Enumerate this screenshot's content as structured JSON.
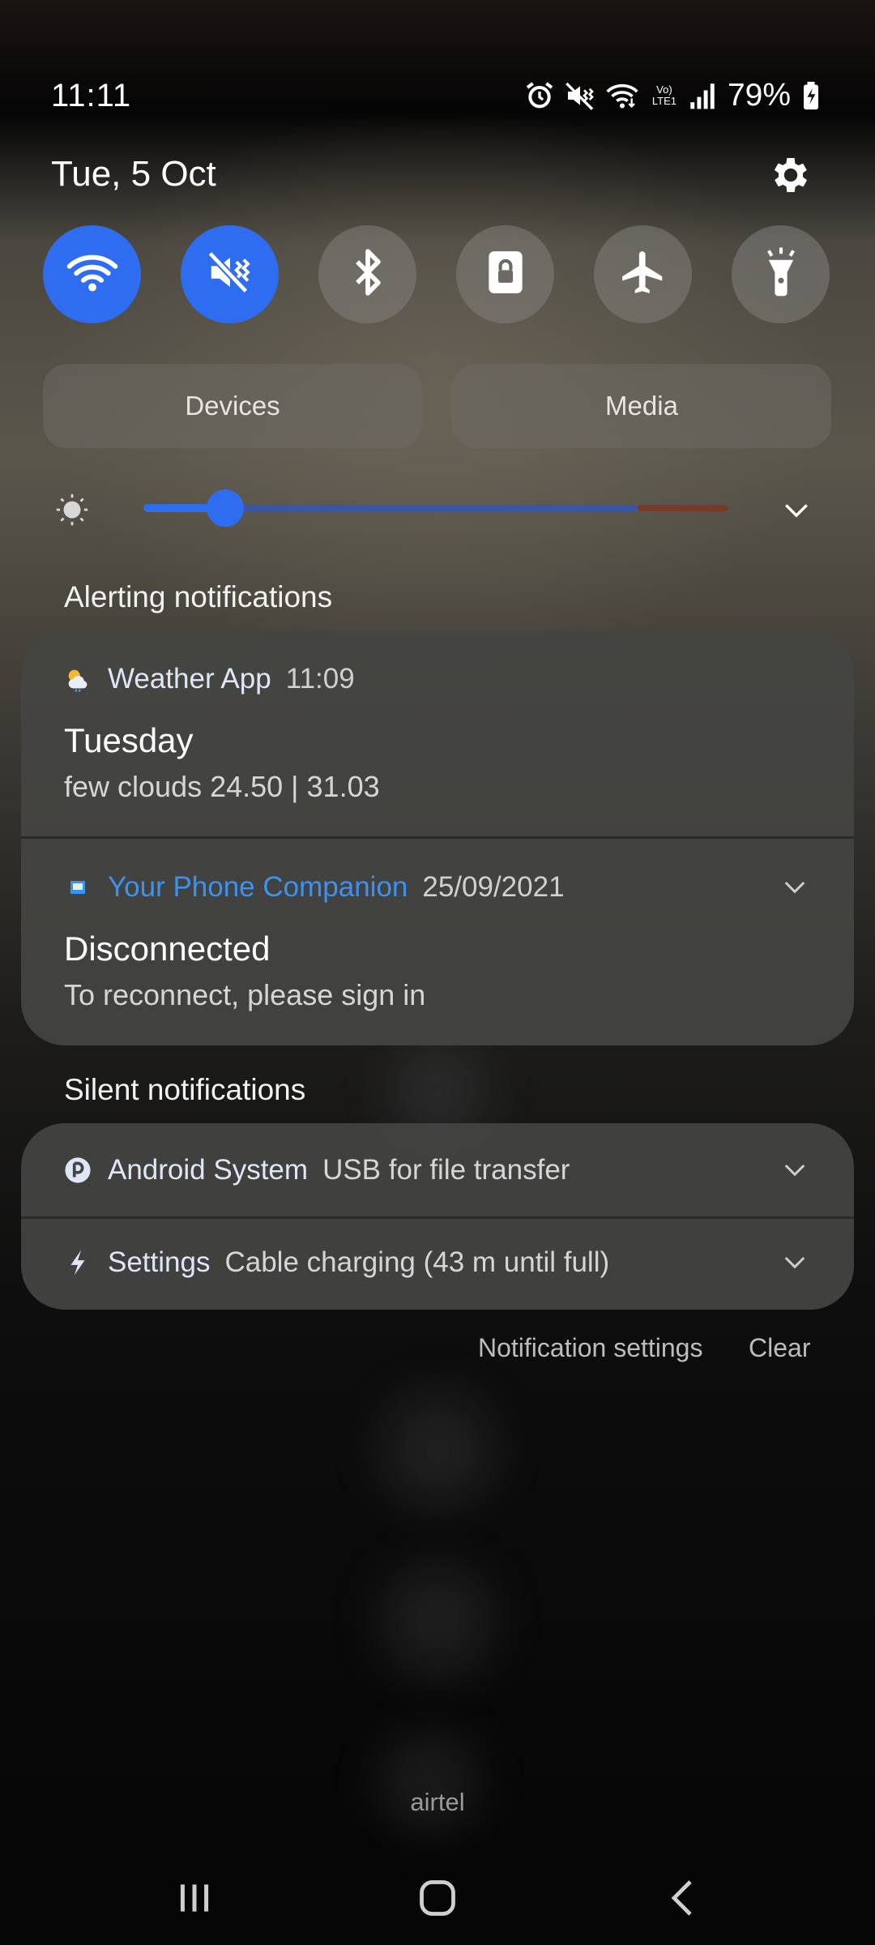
{
  "status_bar": {
    "time": "11:11",
    "battery": "79%",
    "network_label": "Vo) LTE1",
    "icons": [
      "alarm-icon",
      "mute-vibrate-icon",
      "wifi-icon",
      "volte-icon",
      "signal-icon",
      "battery-charging-icon"
    ]
  },
  "date": "Tue, 5 Oct",
  "quick_tiles": [
    {
      "name": "wifi",
      "icon": "wifi-icon",
      "active": true
    },
    {
      "name": "sound",
      "icon": "mute-icon",
      "active": true
    },
    {
      "name": "bluetooth",
      "icon": "bluetooth-icon",
      "active": false
    },
    {
      "name": "lock",
      "icon": "lock-icon",
      "active": false
    },
    {
      "name": "airplane",
      "icon": "airplane-icon",
      "active": false
    },
    {
      "name": "flashlight",
      "icon": "flashlight-icon",
      "active": false
    }
  ],
  "buttons": {
    "devices": "Devices",
    "media": "Media"
  },
  "brightness": {
    "level_fraction": 0.14
  },
  "alerting": {
    "title": "Alerting notifications",
    "items": [
      {
        "app": "Weather App",
        "time": "11:09",
        "title": "Tuesday",
        "text": "few clouds 24.50 | 31.03",
        "icon": "weather-icon"
      },
      {
        "app": "Your Phone Companion",
        "time": "25/09/2021",
        "title": "Disconnected",
        "text": "To reconnect, please sign in",
        "icon": "phone-companion-icon"
      }
    ]
  },
  "silent": {
    "title": "Silent notifications",
    "items": [
      {
        "app": "Android System",
        "text": "USB for file transfer",
        "icon": "android-system-icon"
      },
      {
        "app": "Settings",
        "text": "Cable charging (43 m until full)",
        "icon": "charging-bolt-icon"
      }
    ]
  },
  "footer": {
    "notification_settings": "Notification settings",
    "clear": "Clear"
  },
  "carrier": "airtel",
  "colors": {
    "accent": "#2f6df0",
    "link_blue": "#3a93f3"
  }
}
